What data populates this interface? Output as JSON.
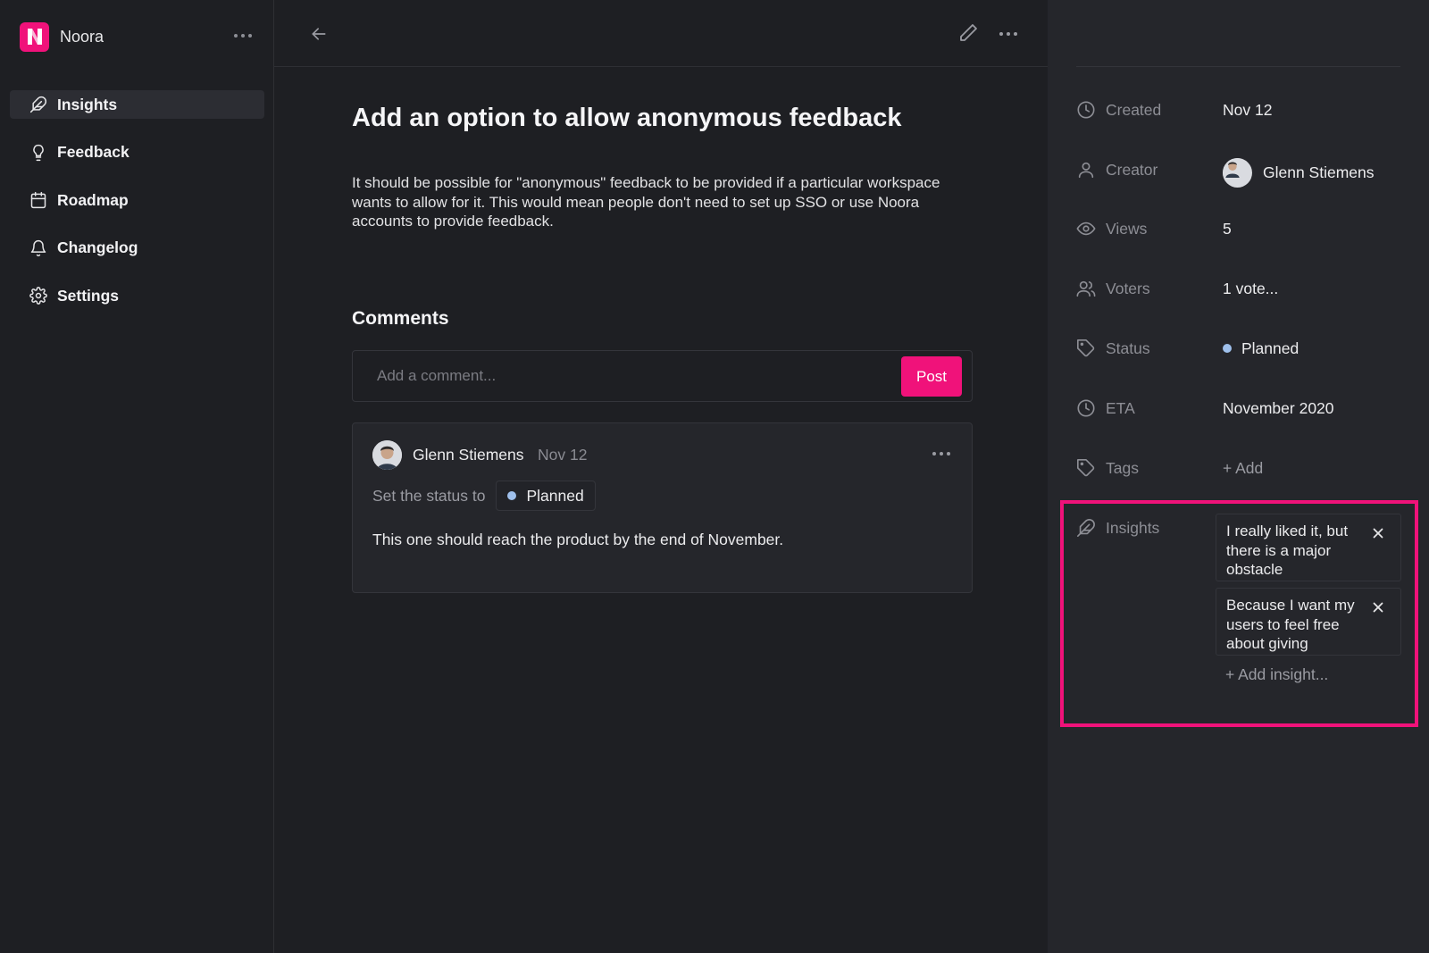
{
  "workspace": {
    "name": "Noora",
    "logo_letter": "N",
    "accent": "#f0127a"
  },
  "sidebar": {
    "items": [
      {
        "label": "Insights",
        "icon": "feather-icon",
        "active": true
      },
      {
        "label": "Feedback",
        "icon": "lightbulb-icon",
        "active": false
      },
      {
        "label": "Roadmap",
        "icon": "calendar-icon",
        "active": false
      },
      {
        "label": "Changelog",
        "icon": "bell-icon",
        "active": false
      },
      {
        "label": "Settings",
        "icon": "gear-icon",
        "active": false
      }
    ]
  },
  "post": {
    "title": "Add an option to allow anonymous feedback",
    "description": "It should be possible for \"anonymous\" feedback to be provided if a particular workspace wants to allow for it. This would mean people don't need to set up SSO or use Noora accounts to provide feedback."
  },
  "comments": {
    "heading": "Comments",
    "input_placeholder": "Add a comment...",
    "post_label": "Post",
    "items": [
      {
        "author": "Glenn Stiemens",
        "date": "Nov 12",
        "status_prefix": "Set the status to",
        "status": "Planned",
        "status_color": "#9fc0ec",
        "body": "This one should reach the product by the end of November."
      }
    ]
  },
  "properties": {
    "created": {
      "label": "Created",
      "value": "Nov 12"
    },
    "creator": {
      "label": "Creator",
      "value": "Glenn Stiemens"
    },
    "views": {
      "label": "Views",
      "value": "5"
    },
    "voters": {
      "label": "Voters",
      "value": "1 vote..."
    },
    "status": {
      "label": "Status",
      "value": "Planned",
      "color": "#9fc0ec"
    },
    "eta": {
      "label": "ETA",
      "value": "November 2020"
    },
    "tags": {
      "label": "Tags",
      "value": "+ Add"
    },
    "insights": {
      "label": "Insights",
      "items": [
        {
          "text": "I really liked it, but there is a major obstacle"
        },
        {
          "text": "Because I want my users to feel free about giving"
        }
      ],
      "add_label": "+ Add insight..."
    }
  }
}
